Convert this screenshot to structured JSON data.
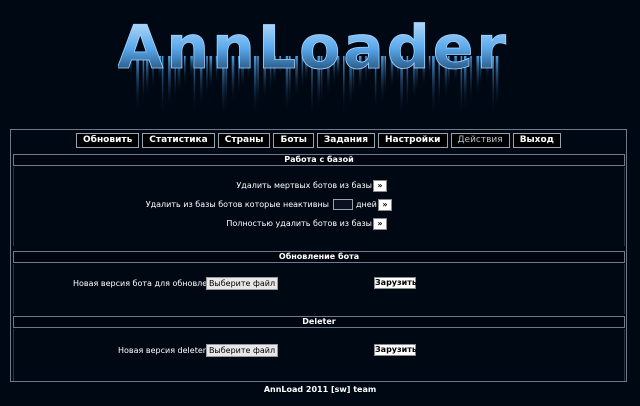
{
  "logo": {
    "text": "AnnLoader"
  },
  "nav": {
    "items": [
      {
        "label": "Обновить"
      },
      {
        "label": "Статистика"
      },
      {
        "label": "Страны"
      },
      {
        "label": "Боты"
      },
      {
        "label": "Задания"
      },
      {
        "label": "Настройки"
      },
      {
        "label": "Действия"
      },
      {
        "label": "Выход"
      }
    ],
    "active": "Действия"
  },
  "db_section": {
    "title": "Работа с базой",
    "delete_dead_label": "Удалить мертвых ботов из базы",
    "delete_inactive_label": "Удалить из базы ботов которые неактивны",
    "days_suffix": "дней",
    "days_value": "",
    "delete_all_label": "Полностью удалить ботов из базы",
    "arrow_label": "»"
  },
  "update_section": {
    "title": "Обновление бота",
    "new_version_label": "Новая версия бота для обновления:",
    "file_button": "Выберите файл",
    "upload_button": "Зарузить"
  },
  "deleter_section": {
    "title": "Deleter",
    "new_version_label": "Новая версия deleter`a:",
    "file_button": "Выберите файл",
    "upload_button": "Зарузить"
  },
  "footer": {
    "text": "AnnLoad 2011 [sw] team"
  },
  "colors": {
    "background": "#000814",
    "border": "#6e7a88",
    "logo_ice": "#7fc4ff"
  }
}
